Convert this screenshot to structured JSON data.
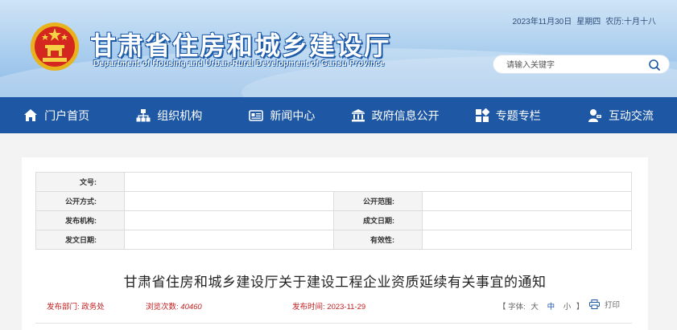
{
  "header": {
    "title": "甘肃省住房和城乡建设厅",
    "subtitle": "Department of Housing and Urban-Rural Development of Gansu Province",
    "date": "2023年11月30日",
    "weekday": "星期四",
    "lunar": "农历:十月十八",
    "search_placeholder": "请输入关键字"
  },
  "nav": {
    "items": [
      {
        "label": "门户首页",
        "icon": "home-icon"
      },
      {
        "label": "组织机构",
        "icon": "org-chart-icon"
      },
      {
        "label": "新闻中心",
        "icon": "news-icon"
      },
      {
        "label": "政府信息公开",
        "icon": "government-building-icon"
      },
      {
        "label": "专题专栏",
        "icon": "grid-icon"
      },
      {
        "label": "互动交流",
        "icon": "user-chat-icon"
      }
    ]
  },
  "meta": {
    "doc_no_label": "文号:",
    "open_mode_label": "公开方式:",
    "open_scope_label": "公开范围:",
    "issuer_label": "发布机构:",
    "created_label": "成文日期:",
    "issue_date_label": "发文日期:",
    "validity_label": "有效性:"
  },
  "article": {
    "title": "甘肃省住房和城乡建设厅关于建设工程企业资质延续有关事宜的通知",
    "dept_label": "发布部门:",
    "dept": "政务处",
    "views_label": "浏览次数:",
    "views": "40460",
    "time_label": "发布时间:",
    "time": "2023-11-29",
    "font_open": "【 字体:",
    "font_large": "大",
    "font_medium": "中",
    "font_small": "小",
    "font_close": "】",
    "print_label": "打印"
  },
  "colors": {
    "nav_bg": "#1e58a5",
    "accent_red": "#c41e1e"
  }
}
